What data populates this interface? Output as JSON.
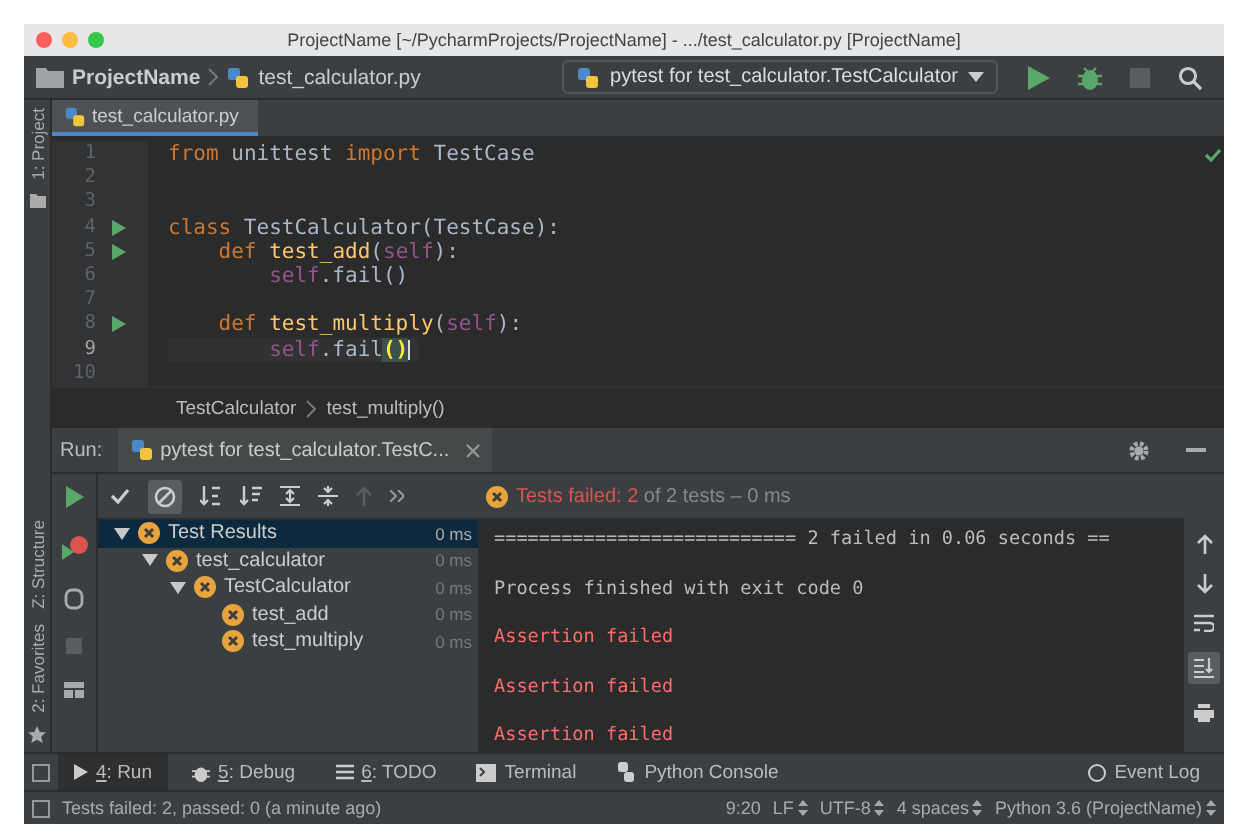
{
  "window": {
    "title": "ProjectName [~/PycharmProjects/ProjectName] - .../test_calculator.py [ProjectName]"
  },
  "navbar": {
    "breadcrumbs": [
      "ProjectName",
      "test_calculator.py"
    ],
    "run_config": "pytest for test_calculator.TestCalculator"
  },
  "left_strip": {
    "top": [
      "1: Project"
    ],
    "bottom": [
      "Z: Structure",
      "2: Favorites"
    ]
  },
  "editor": {
    "tabs": [
      {
        "label": "test_calculator.py",
        "selected": true
      }
    ],
    "lines": [
      {
        "number": "1",
        "current": false,
        "tokens": [
          {
            "kind": "keyword",
            "text": "from"
          },
          {
            "kind": "plain",
            "text": " unittest "
          },
          {
            "kind": "keyword",
            "text": "import"
          },
          {
            "kind": "plain",
            "text": " TestCase"
          }
        ]
      },
      {
        "number": "2",
        "current": false
      },
      {
        "number": "3",
        "current": false
      },
      {
        "number": "4",
        "run": true,
        "current": false,
        "tokens": [
          {
            "kind": "keyword",
            "text": "class"
          },
          {
            "kind": "plain",
            "text": " TestCalculator(TestCase):"
          }
        ]
      },
      {
        "number": "5",
        "run": true,
        "current": false,
        "tokens": [
          {
            "kind": "keyword",
            "text": "    def"
          },
          {
            "kind": "func",
            "text": " test_add"
          },
          {
            "kind": "plain",
            "text": "("
          },
          {
            "kind": "self",
            "text": "self"
          },
          {
            "kind": "plain",
            "text": "):"
          }
        ]
      },
      {
        "number": "6",
        "current": false,
        "tokens": [
          {
            "kind": "self",
            "text": "        self"
          },
          {
            "kind": "plain",
            "text": ".fail()"
          }
        ]
      },
      {
        "number": "7",
        "current": false
      },
      {
        "number": "8",
        "run": true,
        "current": false,
        "tokens": [
          {
            "kind": "keyword",
            "text": "    def"
          },
          {
            "kind": "func",
            "text": " test_multiply"
          },
          {
            "kind": "plain",
            "text": "("
          },
          {
            "kind": "self",
            "text": "self"
          },
          {
            "kind": "plain",
            "text": "):"
          }
        ]
      },
      {
        "number": "9",
        "current": true,
        "tokens": [
          {
            "kind": "self",
            "text": "        self"
          },
          {
            "kind": "plain",
            "text": ".fail"
          },
          {
            "kind": "match",
            "text": "()"
          }
        ]
      },
      {
        "number": "10",
        "current": false
      }
    ],
    "breadcrumbs": [
      "TestCalculator",
      "test_multiply()"
    ]
  },
  "run": {
    "label": "Run:",
    "tab": "pytest for test_calculator.TestC...",
    "summary_failed": "Tests failed: 2",
    "summary_rest": "of 2 tests – 0 ms",
    "tree": [
      {
        "name": "Test Results",
        "time": "0 ms",
        "expanded": true,
        "selected": true,
        "children": [
          {
            "name": "test_calculator",
            "time": "0 ms",
            "expanded": true,
            "selected": false,
            "children": [
              {
                "name": "TestCalculator",
                "time": "0 ms",
                "expanded": true,
                "selected": false,
                "children": [
                  {
                    "name": "test_add",
                    "time": "0 ms",
                    "selected": false
                  },
                  {
                    "name": "test_multiply",
                    "time": "0 ms",
                    "selected": false
                  }
                ]
              }
            ]
          }
        ]
      }
    ],
    "console": [
      {
        "kind": "output",
        "text": "=========================== 2 failed in 0.06 seconds =="
      },
      {
        "kind": "output",
        "text": "Process finished with exit code 0"
      },
      {
        "kind": "error",
        "text": "Assertion failed"
      },
      {
        "kind": "error",
        "text": "Assertion failed"
      },
      {
        "kind": "error",
        "text": "Assertion failed"
      }
    ]
  },
  "tool_tabs": [
    {
      "kind": "run",
      "key": "4",
      "label": ": Run",
      "selected": true
    },
    {
      "kind": "debug",
      "key": "5",
      "label": ": Debug",
      "selected": false
    },
    {
      "kind": "todo",
      "key": "6",
      "label": ": TODO",
      "selected": false
    },
    {
      "kind": "terminal",
      "label": "Terminal",
      "selected": false
    },
    {
      "kind": "console",
      "label": "Python Console",
      "selected": false
    },
    {
      "kind": "log",
      "label": "Event Log",
      "selected": false
    }
  ],
  "status_bar": {
    "message": "Tests failed: 2, passed: 0 (a minute ago)",
    "items": [
      {
        "text": "9:20",
        "dropdown": false
      },
      {
        "text": "LF",
        "dropdown": true
      },
      {
        "text": "UTF-8",
        "dropdown": true
      },
      {
        "text": "4 spaces",
        "dropdown": true
      },
      {
        "text": "Python 3.6 (ProjectName)",
        "dropdown": true
      }
    ]
  }
}
